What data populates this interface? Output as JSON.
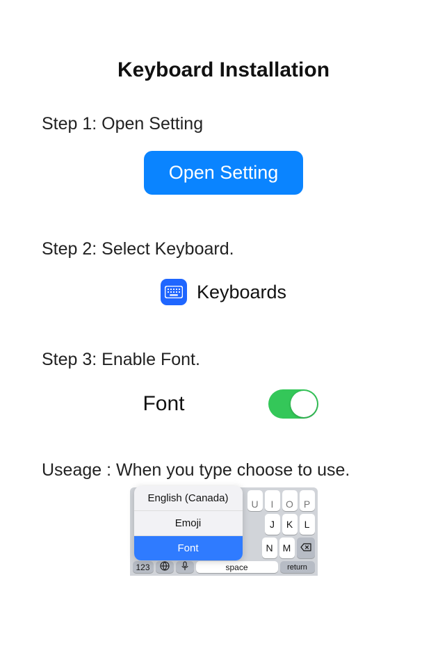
{
  "title": "Keyboard Installation",
  "step1": {
    "label": "Step 1: Open Setting",
    "button": "Open Setting"
  },
  "step2": {
    "label": "Step 2: Select Keyboard.",
    "row_label": "Keyboards"
  },
  "step3": {
    "label": "Step 3: Enable Font.",
    "row_label": "Font",
    "enabled": true
  },
  "usage": {
    "label": "Useage : When you type choose to use.",
    "menu": [
      "English (Canada)",
      "Emoji",
      "Font"
    ],
    "selected": "Font",
    "row1": [
      "U",
      "I",
      "O",
      "P"
    ],
    "row2": [
      "J",
      "K",
      "L"
    ],
    "row3": [
      "N",
      "M"
    ],
    "k123": "123",
    "space": "space",
    "return": "return"
  },
  "colors": {
    "accent": "#0a84ff",
    "toggle_on": "#34c759",
    "menu_selected": "#2f7bff"
  }
}
